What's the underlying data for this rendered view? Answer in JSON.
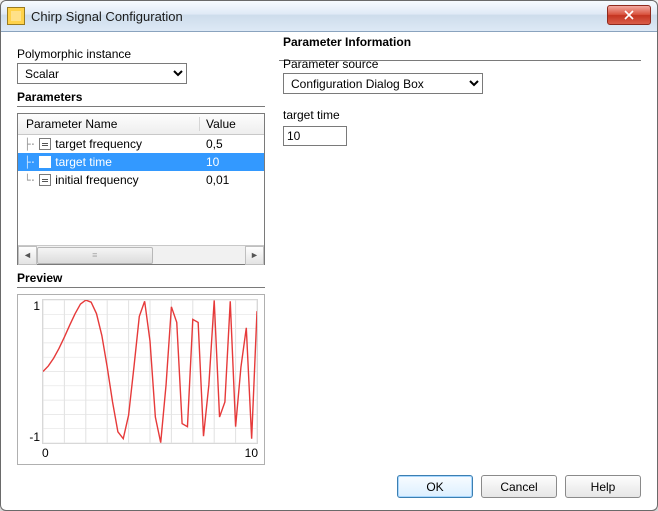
{
  "window": {
    "title": "Chirp Signal Configuration"
  },
  "left": {
    "polymorphic_label": "Polymorphic instance",
    "polymorphic_value": "Scalar",
    "parameters_header": "Parameters",
    "columns": {
      "name": "Parameter Name",
      "value": "Value"
    },
    "rows": [
      {
        "name": "target frequency",
        "value": "0,5",
        "selected": false
      },
      {
        "name": "target time",
        "value": "10",
        "selected": true
      },
      {
        "name": "initial frequency",
        "value": "0,01",
        "selected": false
      }
    ],
    "preview_header": "Preview"
  },
  "right": {
    "group_title": "Parameter Information",
    "source_label": "Parameter source",
    "source_value": "Configuration Dialog Box",
    "field_label": "target time",
    "field_value": "10"
  },
  "footer": {
    "ok": "OK",
    "cancel": "Cancel",
    "help": "Help"
  },
  "chart_data": {
    "type": "line",
    "title": "",
    "xlabel": "",
    "ylabel": "",
    "xlim": [
      0,
      10
    ],
    "ylim": [
      -1,
      1
    ],
    "x_ticks": [
      0,
      10
    ],
    "y_ticks": [
      -1,
      1
    ],
    "grid": true,
    "color": "#e63a3a",
    "description": "chirp: y = sin(2π·(f0·t + (f1−f0)/(2·T)·t²)) with f0=0.01, f1=0.5, T=10",
    "x": [
      0.0,
      0.25,
      0.5,
      0.75,
      1.0,
      1.25,
      1.5,
      1.75,
      2.0,
      2.25,
      2.5,
      2.75,
      3.0,
      3.25,
      3.5,
      3.75,
      4.0,
      4.25,
      4.5,
      4.75,
      5.0,
      5.25,
      5.5,
      5.75,
      6.0,
      6.25,
      6.5,
      6.75,
      7.0,
      7.25,
      7.5,
      7.75,
      8.0,
      8.25,
      8.5,
      8.75,
      9.0,
      9.25,
      9.5,
      9.75,
      10.0
    ],
    "y": [
      0.0,
      0.078,
      0.187,
      0.324,
      0.482,
      0.649,
      0.809,
      0.943,
      0.999,
      0.969,
      0.809,
      0.503,
      0.063,
      -0.426,
      -0.844,
      -0.94,
      -0.611,
      0.063,
      0.771,
      0.982,
      0.426,
      -0.637,
      -0.995,
      -0.188,
      0.905,
      0.687,
      -0.729,
      -0.772,
      0.729,
      0.687,
      -0.905,
      -0.188,
      0.995,
      -0.637,
      -0.426,
      0.982,
      -0.771,
      0.063,
      0.611,
      -0.94,
      0.844
    ]
  }
}
